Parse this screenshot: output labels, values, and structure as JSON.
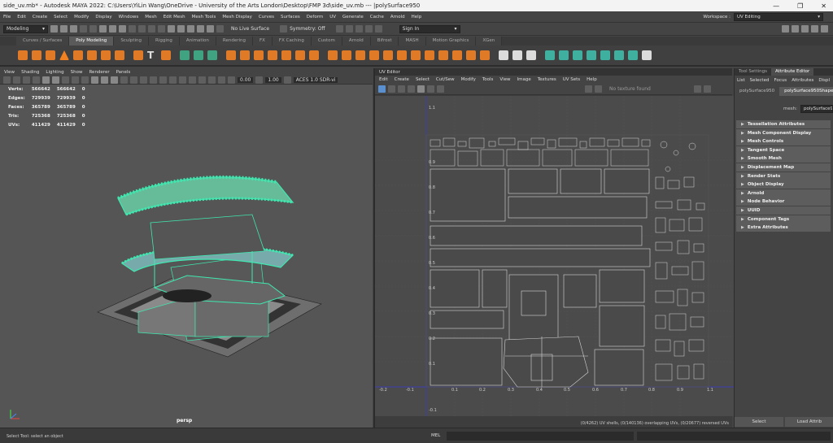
{
  "window": {
    "title": "side_uv.mb* - Autodesk MAYA 2022: C:\\Users\\YiLin Wang\\OneDrive - University of the Arts London\\Desktop\\FMP 3d\\side_uv.mb   ---   |polySurface950",
    "minimize": "—",
    "maximize": "❐",
    "close": "✕"
  },
  "menubar": {
    "items": [
      "File",
      "Edit",
      "Create",
      "Select",
      "Modify",
      "Display",
      "Windows",
      "Mesh",
      "Edit Mesh",
      "Mesh Tools",
      "Mesh Display",
      "Curves",
      "Surfaces",
      "Deform",
      "UV",
      "Generate",
      "Cache",
      "Arnold",
      "Help"
    ],
    "workspace_label": "Workspace :",
    "workspace_value": "UV Editing"
  },
  "statusline": {
    "mode": "Modeling",
    "live_surface": "No Live Surface",
    "symmetry": "Symmetry: Off",
    "sign_in": "Sign In"
  },
  "shelf_tabs": [
    "Curves / Surfaces",
    "Poly Modeling",
    "Sculpting",
    "Rigging",
    "Animation",
    "Rendering",
    "FX",
    "FX Caching",
    "Custom",
    "Arnold",
    "Bifrost",
    "MASH",
    "Motion Graphics",
    "XGen"
  ],
  "shelf_active": "Poly Modeling",
  "viewport": {
    "menu": [
      "View",
      "Shading",
      "Lighting",
      "Show",
      "Renderer",
      "Panels"
    ],
    "field1": "0.00",
    "field2": "1.00",
    "colorspace": "ACES 1.0 SDR-vi",
    "hud": [
      {
        "label": "Verts:",
        "a": "566642",
        "b": "566642",
        "c": "0"
      },
      {
        "label": "Edges:",
        "a": "729939",
        "b": "729939",
        "c": "0"
      },
      {
        "label": "Faces:",
        "a": "365789",
        "b": "365789",
        "c": "0"
      },
      {
        "label": "Tris:",
        "a": "725368",
        "b": "725368",
        "c": "0"
      },
      {
        "label": "UVs:",
        "a": "411429",
        "b": "411429",
        "c": "0"
      }
    ],
    "camera": "persp"
  },
  "uv_editor": {
    "title": "UV Editor",
    "menu": [
      "Edit",
      "Create",
      "Select",
      "Cut/Sew",
      "Modify",
      "Tools",
      "View",
      "Image",
      "Textures",
      "UV Sets",
      "Help"
    ],
    "texture": "No texture found",
    "footer": "(0/4262) UV shells, (0/140136) overlapping UVs, (0/20677) reversed UVs",
    "axis_labels_x": [
      "-0.2",
      "-0.1",
      "0.1",
      "0.2",
      "0.3",
      "0.4",
      "0.5",
      "0.6",
      "0.7",
      "0.8",
      "0.9",
      "1.1"
    ],
    "axis_labels_y": [
      "1.1",
      "0.9",
      "0.8",
      "0.7",
      "0.6",
      "0.5",
      "0.4",
      "0.3",
      "0.2",
      "0.1",
      "-0.1"
    ]
  },
  "attribute_editor": {
    "tabs": [
      "Tool Settings",
      "Attribute Editor"
    ],
    "menu": [
      "List",
      "Selected",
      "Focus",
      "Attributes",
      "Displ"
    ],
    "nodes": [
      "polySurface950",
      "polySurface950Shape"
    ],
    "mesh_label": "mesh:",
    "mesh_value": "polySurface950",
    "sections": [
      "Tessellation Attributes",
      "Mesh Component Display",
      "Mesh Controls",
      "Tangent Space",
      "Smooth Mesh",
      "Displacement Map",
      "Render Stats",
      "Object Display",
      "Arnold",
      "Node Behavior",
      "UUID",
      "Component Tags",
      "Extra Attributes"
    ],
    "select_btn": "Select",
    "load_btn": "Load Attrib"
  },
  "helpline": {
    "text": "Select Tool: select an object",
    "mel": "MEL"
  },
  "colors": {
    "accent": "#3fe8b0",
    "shelf_orange": "#e07a26",
    "background": "#444444"
  }
}
